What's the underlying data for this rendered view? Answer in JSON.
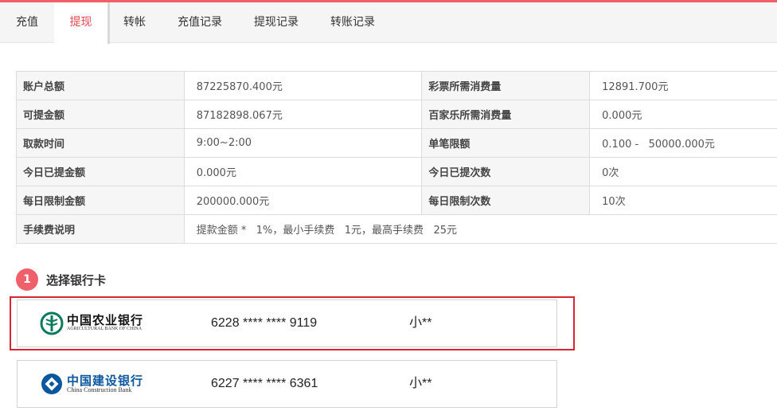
{
  "tabs": [
    {
      "label": "充值"
    },
    {
      "label": "提现"
    },
    {
      "label": "转帐"
    },
    {
      "label": "充值记录"
    },
    {
      "label": "提现记录"
    },
    {
      "label": "转账记录"
    }
  ],
  "active_tab": "提现",
  "account_table": {
    "rows": [
      {
        "l1": "账户总额",
        "v1": "87225870.400元",
        "l2": "彩票所需消费量",
        "v2": "12891.700元"
      },
      {
        "l1": "可提金额",
        "v1": "87182898.067元",
        "l2": "百家乐所需消费量",
        "v2": "0.000元"
      },
      {
        "l1": "取款时间",
        "v1": "9:00~2:00",
        "l2": "单笔限额",
        "v2": "0.100 -   50000.000元"
      },
      {
        "l1": "今日已提金额",
        "v1": "0.000元",
        "l2": "今日已提次数",
        "v2": "0次"
      },
      {
        "l1": "每日限制金额",
        "v1": "200000.000元",
        "l2": "每日限制次数",
        "v2": "10次"
      }
    ],
    "fee": {
      "label": "手续费说明",
      "value": "提款金额 *   1%，最小手续费   1元，最高手续费   25元"
    }
  },
  "step": {
    "number": "1",
    "title": "选择银行卡"
  },
  "cards": [
    {
      "bank_cn": "中国农业银行",
      "bank_en": "AGRICULTURAL BANK OF CHINA",
      "number": "6228 **** **** 9119",
      "holder": "小**",
      "logo_icon": "abc-bank-logo",
      "color": "#0b7a5e",
      "selected": true
    },
    {
      "bank_cn": "中国建设银行",
      "bank_en": "China Construction Bank",
      "number": "6227 **** **** 6361",
      "holder": "小**",
      "logo_icon": "ccb-bank-logo",
      "color": "#0a57a0",
      "selected": false
    }
  ],
  "colors": {
    "accent": "#f0606a",
    "active_tab_text": "#e9474f",
    "selection_outline": "#d8262e"
  }
}
